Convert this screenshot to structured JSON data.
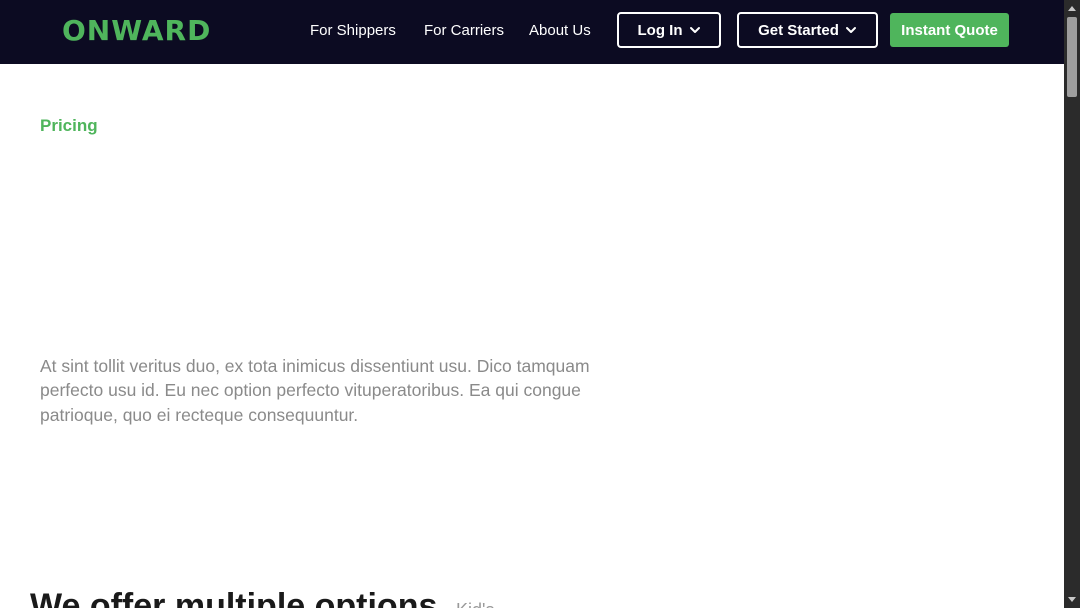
{
  "header": {
    "logo": "ONWARD",
    "nav": {
      "shippers": "For Shippers",
      "carriers": "For Carriers",
      "about": "About Us"
    },
    "login_label": "Log In",
    "get_started_label": "Get Started",
    "quote_label": "Instant Quote"
  },
  "main": {
    "section_label": "Pricing",
    "intro": "At sint tollit veritus duo, ex tota inimicus dissentiunt usu. Dico tamquam perfecto usu id. Eu nec option perfecto vituperatoribus. Ea qui congue patrioque, quo ei recteque consequuntur.",
    "heading": "We offer multiple options",
    "heading_aside": "Kid's"
  },
  "colors": {
    "header_bg": "#0c0b22",
    "brand_green": "#4fb55c",
    "body_text_gray": "#8a8a8a"
  }
}
